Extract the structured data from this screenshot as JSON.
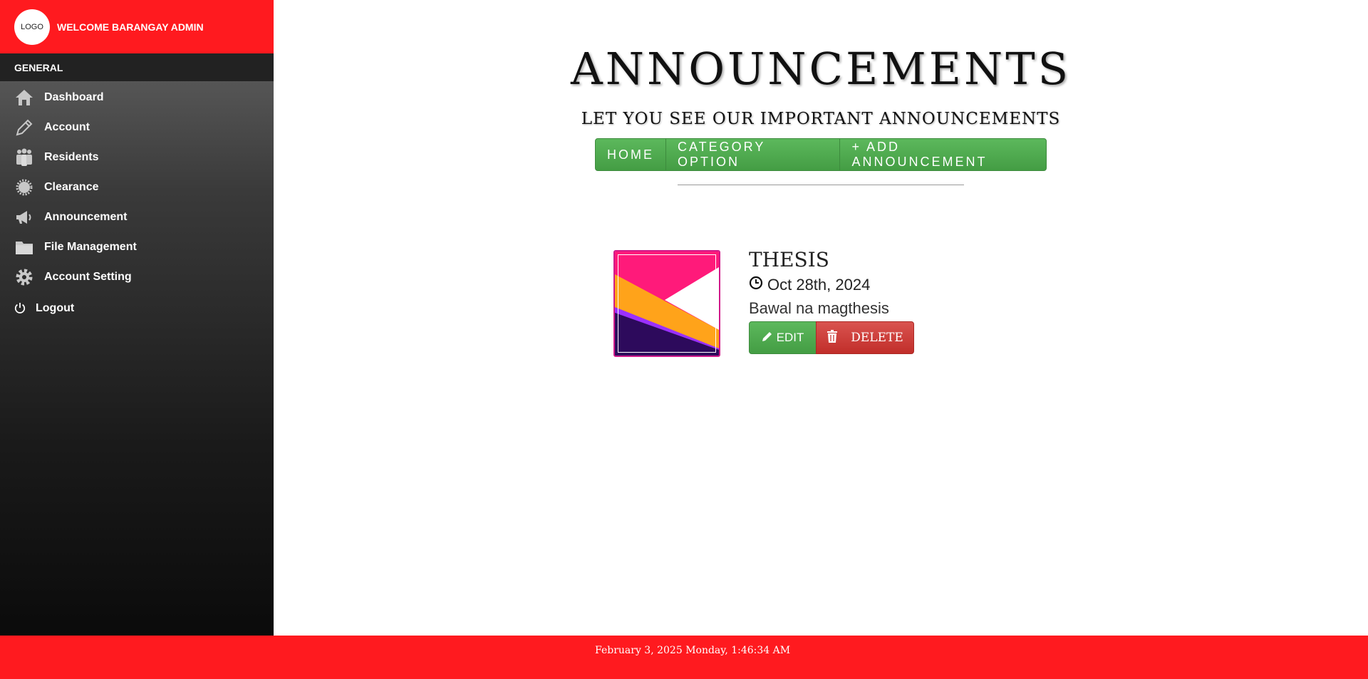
{
  "brand": {
    "logo_text": "LOGO",
    "welcome": "WELCOME BARANGAY ADMIN",
    "color": "#ff1a1f"
  },
  "sidebar": {
    "section_label": "GENERAL",
    "items": [
      {
        "label": "Dashboard",
        "icon": "home-icon"
      },
      {
        "label": "Account",
        "icon": "pencil-icon"
      },
      {
        "label": "Residents",
        "icon": "people-icon"
      },
      {
        "label": "Clearance",
        "icon": "badge-icon"
      },
      {
        "label": "Announcement",
        "icon": "megaphone-icon"
      },
      {
        "label": "File Management",
        "icon": "folder-icon"
      },
      {
        "label": "Account Setting",
        "icon": "gear-icon"
      },
      {
        "label": "Logout",
        "icon": "power-icon"
      }
    ]
  },
  "page": {
    "title": "ANNOUNCEMENTS",
    "subtitle": "LET YOU SEE OUR IMPORTANT ANNOUNCEMENTS"
  },
  "nav": {
    "home": "HOME",
    "category": "CATEGORY OPTION",
    "add": "+ ADD ANNOUNCEMENT"
  },
  "announcement": {
    "title": "THESIS",
    "date": "Oct 28th, 2024",
    "body": "Bawal na magthesis",
    "edit_label": "EDIT",
    "delete_label": "DELETE"
  },
  "footer": {
    "datetime": "February 3, 2025 Monday, 1:46:34 AM"
  }
}
